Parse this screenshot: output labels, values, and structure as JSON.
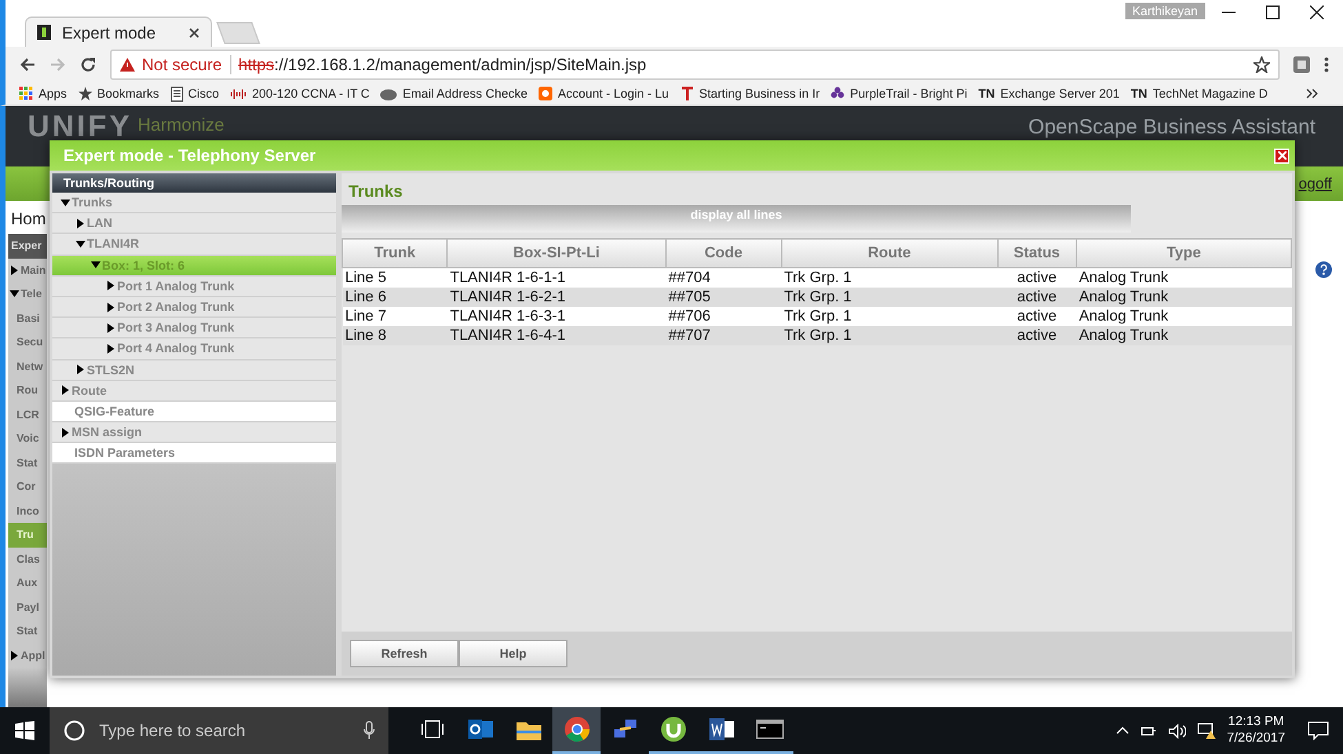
{
  "browser": {
    "tab_title": "Expert mode",
    "profile": "Karthikeyan",
    "security": "Not secure",
    "url_scheme": "https",
    "url_rest": "://192.168.1.2/management/admin/jsp/SiteMain.jsp",
    "bookmarks": [
      {
        "label": "Apps",
        "kind": "apps"
      },
      {
        "label": "Bookmarks",
        "kind": "star"
      },
      {
        "label": "Cisco",
        "kind": "page"
      },
      {
        "label": "200-120 CCNA - IT C",
        "kind": "cisco"
      },
      {
        "label": "Email Address Checke",
        "kind": "cloud"
      },
      {
        "label": "Account - Login - Lu",
        "kind": "badge"
      },
      {
        "label": "Starting Business in Ir",
        "kind": "letter"
      },
      {
        "label": "PurpleTrail - Bright Pi",
        "kind": "flower"
      },
      {
        "label": "Exchange Server 201",
        "kind": "tn",
        "prefix": "TN"
      },
      {
        "label": "TechNet Magazine D",
        "kind": "tn",
        "prefix": "TN"
      }
    ]
  },
  "app": {
    "brand": "UNIFY",
    "product": "Harmonize",
    "title": "OpenScape Business Assistant",
    "logoff": "ogoff",
    "home": "Hom",
    "menu": [
      {
        "label": "Exper",
        "kind": "header"
      },
      {
        "label": "Main",
        "kind": "folder",
        "expanded": false
      },
      {
        "label": "Tele",
        "kind": "folder",
        "expanded": true
      },
      {
        "label": "Basi",
        "kind": "item",
        "selected": false
      },
      {
        "label": "Secu",
        "kind": "item",
        "selected": false
      },
      {
        "label": "Netw",
        "kind": "item",
        "selected": false
      },
      {
        "label": "Rou",
        "kind": "item",
        "selected": false
      },
      {
        "label": "LCR",
        "kind": "item",
        "selected": false
      },
      {
        "label": "Voic",
        "kind": "item",
        "selected": false
      },
      {
        "label": "Stat",
        "kind": "item",
        "selected": false
      },
      {
        "label": "Cor",
        "kind": "item",
        "selected": false
      },
      {
        "label": "Inco",
        "kind": "item",
        "selected": false
      },
      {
        "label": "Tru",
        "kind": "item",
        "selected": true
      },
      {
        "label": "Clas",
        "kind": "item",
        "selected": false
      },
      {
        "label": "Aux",
        "kind": "item",
        "selected": false
      },
      {
        "label": "Payl",
        "kind": "item",
        "selected": false
      },
      {
        "label": "Stat",
        "kind": "item",
        "selected": false
      },
      {
        "label": "Appl",
        "kind": "folder",
        "expanded": false
      }
    ]
  },
  "dialog": {
    "title": "Expert mode - Telephony Server",
    "tree_title": "Trunks/Routing",
    "tree": [
      {
        "label": "Trunks",
        "kind": "folder",
        "expanded": true,
        "selected": false,
        "children": [
          {
            "label": "LAN",
            "kind": "folder",
            "expanded": false,
            "selected": false
          },
          {
            "label": "TLANI4R",
            "kind": "folder",
            "expanded": true,
            "selected": false,
            "children": [
              {
                "label": "Box: 1, Slot: 6",
                "kind": "folder",
                "expanded": true,
                "selected": true,
                "children": [
                  {
                    "label": "Port 1 Analog Trunk",
                    "kind": "folder",
                    "expanded": false,
                    "selected": false
                  },
                  {
                    "label": "Port 2 Analog Trunk",
                    "kind": "folder",
                    "expanded": false,
                    "selected": false
                  },
                  {
                    "label": "Port 3 Analog Trunk",
                    "kind": "folder",
                    "expanded": false,
                    "selected": false
                  },
                  {
                    "label": "Port 4 Analog Trunk",
                    "kind": "folder",
                    "expanded": false,
                    "selected": false
                  }
                ]
              }
            ]
          },
          {
            "label": "STLS2N",
            "kind": "folder",
            "expanded": false,
            "selected": false
          }
        ]
      },
      {
        "label": "Route",
        "kind": "folder",
        "expanded": false,
        "selected": false
      },
      {
        "label": "QSIG-Feature",
        "kind": "leaf",
        "selected": false
      },
      {
        "label": "MSN assign",
        "kind": "folder",
        "expanded": false,
        "selected": false
      },
      {
        "label": "ISDN Parameters",
        "kind": "leaf",
        "selected": false
      }
    ],
    "heading": "Trunks",
    "filter": "display all lines",
    "columns": [
      "Trunk",
      "Box-SI-Pt-Li",
      "Code",
      "Route",
      "Status",
      "Type"
    ],
    "rows": [
      [
        "Line 5",
        "TLANI4R 1-6-1-1",
        "##704",
        "Trk Grp. 1",
        "active",
        "Analog Trunk"
      ],
      [
        "Line 6",
        "TLANI4R 1-6-2-1",
        "##705",
        "Trk Grp. 1",
        "active",
        "Analog Trunk"
      ],
      [
        "Line 7",
        "TLANI4R 1-6-3-1",
        "##706",
        "Trk Grp. 1",
        "active",
        "Analog Trunk"
      ],
      [
        "Line 8",
        "TLANI4R 1-6-4-1",
        "##707",
        "Trk Grp. 1",
        "active",
        "Analog Trunk"
      ]
    ],
    "buttons": [
      "Refresh",
      "Help"
    ]
  },
  "taskbar": {
    "search_placeholder": "Type here to search",
    "apps": [
      {
        "kind": "outlook",
        "selected": false,
        "running": false
      },
      {
        "kind": "explorer",
        "selected": false,
        "running": false
      },
      {
        "kind": "chrome",
        "selected": true,
        "running": true
      },
      {
        "kind": "network",
        "selected": false,
        "running": false
      },
      {
        "kind": "torrent",
        "selected": false,
        "running": true
      },
      {
        "kind": "word",
        "selected": false,
        "running": true
      },
      {
        "kind": "terminal",
        "selected": false,
        "running": true
      }
    ],
    "time": "12:13 PM",
    "date": "7/26/2017"
  }
}
